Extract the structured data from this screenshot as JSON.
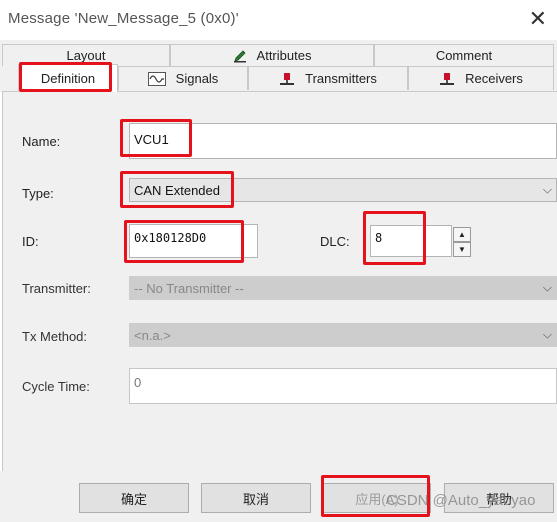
{
  "window": {
    "title": "Message 'New_Message_5 (0x0)'",
    "close": "✕"
  },
  "tabs": {
    "layout": "Layout",
    "attributes": "Attributes",
    "comment": "Comment",
    "definition": "Definition",
    "signals": "Signals",
    "transmitters": "Transmitters",
    "receivers": "Receivers"
  },
  "form": {
    "name_label": "Name:",
    "name_value": "VCU1",
    "type_label": "Type:",
    "type_value": "CAN Extended",
    "id_label": "ID:",
    "id_value": "0x180128D0",
    "dlc_label": "DLC:",
    "dlc_value": "8",
    "transmitter_label": "Transmitter:",
    "transmitter_value": "-- No Transmitter --",
    "txmethod_label": "Tx Method:",
    "txmethod_value": "<n.a.>",
    "cycletime_label": "Cycle Time:",
    "cycletime_value": "0"
  },
  "buttons": {
    "ok": "确定",
    "cancel": "取消",
    "apply": "应用(A)",
    "help": "帮助"
  },
  "watermark": "CSDN @Auto_yaoyao",
  "colors": {
    "highlight": "#e5121b",
    "icon_red": "#c8102e"
  },
  "icons": [
    "pencil-icon",
    "signal-wave-icon",
    "transmitter-icon",
    "receiver-icon"
  ]
}
